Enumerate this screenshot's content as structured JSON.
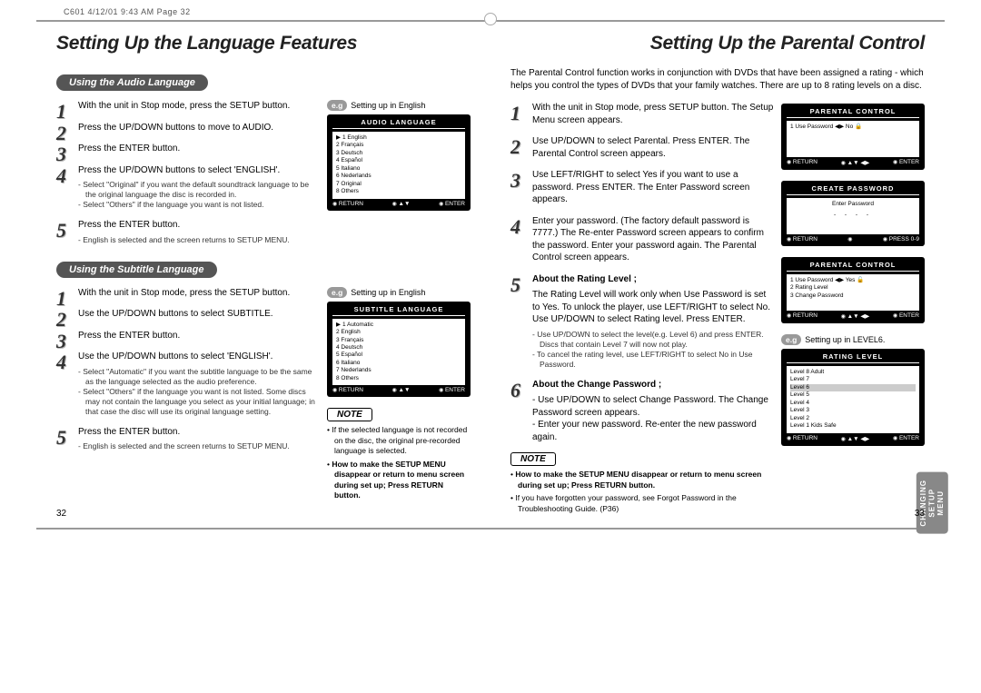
{
  "print_meta": "C601  4/12/01 9:43 AM  Page 32",
  "left": {
    "title": "Setting Up the Language Features",
    "audio": {
      "heading": "Using the Audio Language",
      "eg": "Setting up in English",
      "tv_title": "AUDIO LANGUAGE",
      "tv_list": [
        "1 English",
        "2 Français",
        "3 Deutsch",
        "4 Español",
        "5 Italiano",
        "6 Nederlands",
        "7 Original",
        "8 Others"
      ],
      "tv_return": "RETURN",
      "tv_enter": "ENTER",
      "steps": [
        {
          "t": "With the unit in Stop mode, press the SETUP button."
        },
        {
          "t": "Press the UP/DOWN buttons to move to AUDIO."
        },
        {
          "t": "Press the ENTER button."
        },
        {
          "t": "Press the UP/DOWN buttons to select 'ENGLISH'.",
          "sub": [
            "- Select \"Original\" if you want the default soundtrack language to be the original language the disc is recorded in.",
            "- Select \"Others\" if the language you want is not listed."
          ]
        },
        {
          "t": "Press the ENTER button.",
          "sub": [
            "- English is selected and the screen returns to SETUP MENU."
          ]
        }
      ]
    },
    "subtitle": {
      "heading": "Using the Subtitle Language",
      "eg": "Setting up in English",
      "tv_title": "SUBTITLE LANGUAGE",
      "tv_list": [
        "1 Automatic",
        "2 English",
        "3 Français",
        "4 Deutsch",
        "5 Español",
        "6 Italiano",
        "7 Nederlands",
        "8 Others"
      ],
      "tv_return": "RETURN",
      "tv_enter": "ENTER",
      "steps": [
        {
          "t": "With the unit in Stop mode, press the SETUP button."
        },
        {
          "t": "Use the UP/DOWN buttons to select SUBTITLE."
        },
        {
          "t": "Press the ENTER button."
        },
        {
          "t": "Use the UP/DOWN buttons to select 'ENGLISH'.",
          "sub": [
            "- Select \"Automatic\" if you want the subtitle language to be the same as the language selected as the audio preference.",
            "- Select \"Others\" if the language you want is not listed. Some discs may not contain the language you select as your initial language; in that case the disc will use its original language setting."
          ]
        },
        {
          "t": "Press the ENTER button.",
          "sub": [
            "- English is selected and the screen returns to SETUP MENU."
          ]
        }
      ]
    },
    "note": {
      "label": "NOTE",
      "items": [
        "If the selected language is not recorded on the disc, the original pre-recorded language is selected.",
        "How to make the SETUP MENU disappear or return to menu screen during set up; Press RETURN button."
      ]
    },
    "pagenum": "32"
  },
  "right": {
    "title": "Setting Up the Parental Control",
    "intro": "The Parental Control function works in conjunction with DVDs that have been assigned a rating - which helps you control the types of DVDs that your family watches. There are up to 8 rating levels on a disc.",
    "tv1": {
      "title": "PARENTAL CONTROL",
      "body": "1 Use Password   ◀▶  No  🔒",
      "return": "RETURN",
      "nav": "▲▼ ◀▶",
      "enter": "ENTER"
    },
    "tv2": {
      "title": "CREATE PASSWORD",
      "body": "Enter Password",
      "dashes": "- - - -",
      "return": "RETURN",
      "enter": "PRESS 0-9"
    },
    "tv3": {
      "title": "PARENTAL CONTROL",
      "rows": [
        "1 Use Password   ◀▶  Yes 🔓",
        "2 Rating Level",
        "3 Change Password"
      ],
      "return": "RETURN",
      "nav": "▲▼ ◀▶",
      "enter": "ENTER"
    },
    "eg": "Setting up in LEVEL6.",
    "tv4": {
      "title": "RATING LEVEL",
      "rows": [
        "Level 8 Adult",
        "Level 7",
        "Level 6",
        "Level 5",
        "Level 4",
        "Level 3",
        "Level 2",
        "Level 1 Kids Safe"
      ],
      "return": "RETURN",
      "nav": "▲▼ ◀▶",
      "enter": "ENTER"
    },
    "steps": [
      {
        "t": "With the unit in Stop mode, press SETUP button. The Setup Menu screen appears."
      },
      {
        "t": "Use UP/DOWN to select Parental. Press ENTER. The Parental Control screen appears."
      },
      {
        "t": "Use LEFT/RIGHT to select Yes if you want to use a password. Press ENTER. The Enter Password screen appears."
      },
      {
        "t": "Enter your password. (The factory default password is 7777.) The Re-enter Password screen appears to confirm the password. Enter your password again. The Parental Control screen appears."
      },
      {
        "t": "About the Rating Level ;",
        "body": "The Rating Level will work only when Use Password is set to Yes. To unlock the player, use LEFT/RIGHT to select No. Use UP/DOWN to select Rating level. Press ENTER.",
        "sub": [
          "- Use UP/DOWN to select the level(e.g. Level 6) and press ENTER. Discs that contain Level 7 will now not play.",
          "- To cancel the rating level, use LEFT/RIGHT to select No in Use Password."
        ]
      },
      {
        "t": "About the Change Password ;",
        "body": "- Use UP/DOWN to select Change Password. The Change Password screen appears.\n- Enter your new password. Re-enter the new password again."
      }
    ],
    "note": {
      "label": "NOTE",
      "items": [
        "How to make the SETUP MENU disappear or return to menu screen during set up; Press RETURN button.",
        "If you have forgotten your password, see Forgot Password in the Troubleshooting Guide. (P36)"
      ]
    },
    "sidetab": "CHANGING\nSETUP MENU",
    "pagenum": "33"
  }
}
